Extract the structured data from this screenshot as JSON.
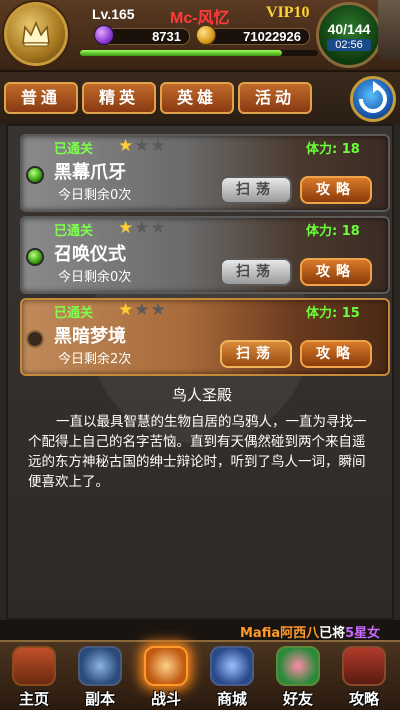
{
  "player": {
    "level": "Lv.165",
    "name": "Mc-风忆",
    "vip": "VIP10",
    "gems": "8731",
    "gold": "71022926",
    "exp_fraction": 0.85,
    "energy": "40/144",
    "energy_timer": "02:56"
  },
  "icons": {
    "badge": "crown-badge-icon",
    "gem": "purple-gem-icon",
    "gold": "gold-coin-icon",
    "refresh": "refresh-arrows-icon"
  },
  "tabs": [
    {
      "label": "普通"
    },
    {
      "label": "精英"
    },
    {
      "label": "英雄"
    },
    {
      "label": "活动"
    }
  ],
  "stages": [
    {
      "status": "已通关",
      "stars": 1,
      "stamina": "体力: 18",
      "name": "黑幕爪牙",
      "remaining": "今日剩余0次",
      "sweep": "扫荡",
      "guide": "攻略"
    },
    {
      "status": "已通关",
      "stars": 1,
      "stamina": "体力: 18",
      "name": "召唤仪式",
      "remaining": "今日剩余0次",
      "sweep": "扫荡",
      "guide": "攻略"
    },
    {
      "status": "已通关",
      "stars": 1,
      "stamina": "体力: 15",
      "name": "黑暗梦境",
      "remaining": "今日剩余2次",
      "sweep": "扫荡",
      "guide": "攻略"
    }
  ],
  "description": {
    "title": "鸟人圣殿",
    "body": "一直以最具智慧的生物自居的乌鸦人，一直为寻找一个配得上自己的名字苦恼。直到有天偶然碰到两个来自遥远的东方神秘古国的绅士辩论时，听到了鸟人一词，瞬间便喜欢上了。"
  },
  "ticker": {
    "player": "Mafia阿西八",
    "text": "已将",
    "highlight": "5星女"
  },
  "nav": [
    {
      "label": "主页",
      "icon": "house-icon"
    },
    {
      "label": "副本",
      "icon": "knight-helmet-icon"
    },
    {
      "label": "战斗",
      "icon": "crossed-swords-icon"
    },
    {
      "label": "商城",
      "icon": "owl-shop-icon"
    },
    {
      "label": "好友",
      "icon": "friends-icon"
    },
    {
      "label": "攻略",
      "icon": "book-icon"
    }
  ],
  "colors": {
    "cleared": "#7cff4a",
    "stamina": "#6aff3a",
    "name_red": "#ff3b3b",
    "vip_gold": "#ffd233",
    "ticker_player": "#ff9a2a",
    "ticker_highlight": "#c86aff"
  }
}
